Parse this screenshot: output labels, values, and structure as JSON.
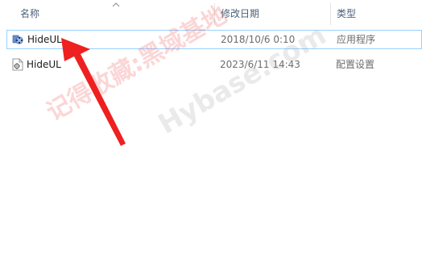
{
  "columns": {
    "name": "名称",
    "date": "修改日期",
    "type": "类型"
  },
  "files": [
    {
      "name": "HideUL",
      "date": "2018/10/6 0:10",
      "type": "应用程序",
      "icon": "application-icon",
      "selected": true
    },
    {
      "name": "HideUL",
      "date": "2023/6/11 14:43",
      "type": "配置设置",
      "icon": "config-settings-icon",
      "selected": false
    }
  ],
  "watermark": {
    "cn": "记得收藏:黑域基地",
    "en": "Hybase.com"
  },
  "colors": {
    "arrow": "#ee2020",
    "selection_border": "#99d1ff",
    "header_text": "#4c607a"
  }
}
